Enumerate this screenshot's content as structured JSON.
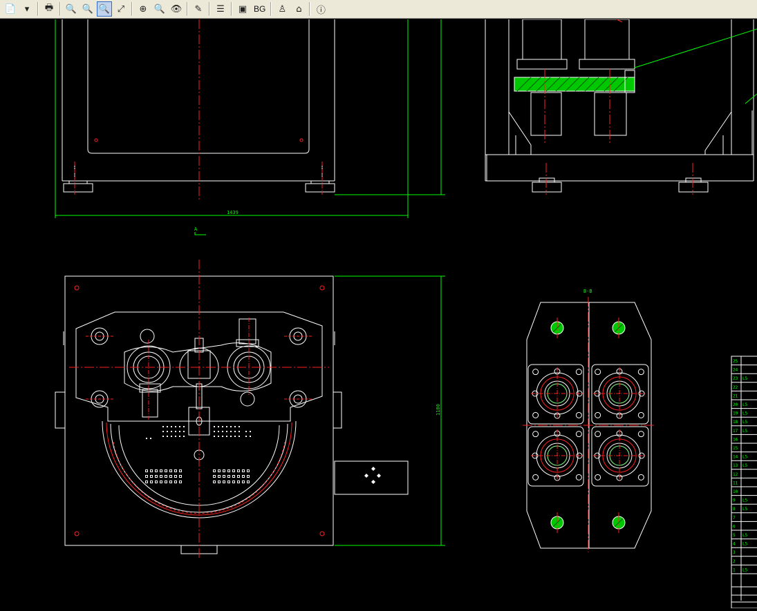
{
  "toolbar": {
    "items": [
      {
        "name": "open-file-icon",
        "glyph": "📄"
      },
      {
        "name": "dropdown-arrow-icon",
        "glyph": "▾"
      },
      {
        "name": "sep"
      },
      {
        "name": "print-icon",
        "glyph": "🖶"
      },
      {
        "name": "sep"
      },
      {
        "name": "zoom-out-icon",
        "glyph": "🔍"
      },
      {
        "name": "zoom-in-icon",
        "glyph": "🔍"
      },
      {
        "name": "zoom-window-icon",
        "glyph": "🔍",
        "active": true
      },
      {
        "name": "zoom-realtime-icon",
        "glyph": "⤢"
      },
      {
        "name": "sep"
      },
      {
        "name": "pan-icon",
        "glyph": "⊕"
      },
      {
        "name": "zoom-extents-icon",
        "glyph": "🔍"
      },
      {
        "name": "view-eye-icon",
        "glyph": "👁"
      },
      {
        "name": "sep"
      },
      {
        "name": "measure-icon",
        "glyph": "✎"
      },
      {
        "name": "sep"
      },
      {
        "name": "layers-icon",
        "glyph": "☰"
      },
      {
        "name": "sep"
      },
      {
        "name": "model-layout-icon",
        "glyph": "▣"
      },
      {
        "name": "background-button",
        "glyph": "BG",
        "text": true
      },
      {
        "name": "sep"
      },
      {
        "name": "user-icon",
        "glyph": "♙"
      },
      {
        "name": "home-icon",
        "glyph": "⌂"
      },
      {
        "name": "sep"
      },
      {
        "name": "info-icon",
        "glyph": "ⓘ"
      }
    ]
  },
  "drawing": {
    "dim_width": "1439",
    "dim_height": "1180",
    "section_a_label": "A",
    "section_bb_label": "B-B",
    "bom_rows": [
      "25",
      "24",
      "23",
      "22",
      "21",
      "20",
      "19",
      "18",
      "17",
      "16",
      "15",
      "14",
      "13",
      "12",
      "11",
      "10",
      "9",
      "8",
      "7",
      "6",
      "5",
      "4",
      "3",
      "2",
      "1"
    ],
    "bom_letters": [
      "",
      "",
      "L5",
      "",
      "",
      "L5",
      "L5",
      "L5",
      "L5",
      "",
      "",
      "L5",
      "L5",
      "",
      "",
      "",
      "L5",
      "L5",
      "",
      "",
      "L5",
      "L5",
      "",
      "",
      "L5"
    ]
  },
  "colors": {
    "outline": "#ffffff",
    "center": "#ff2020",
    "dimension": "#00ff00",
    "hatch": "#00c800"
  }
}
